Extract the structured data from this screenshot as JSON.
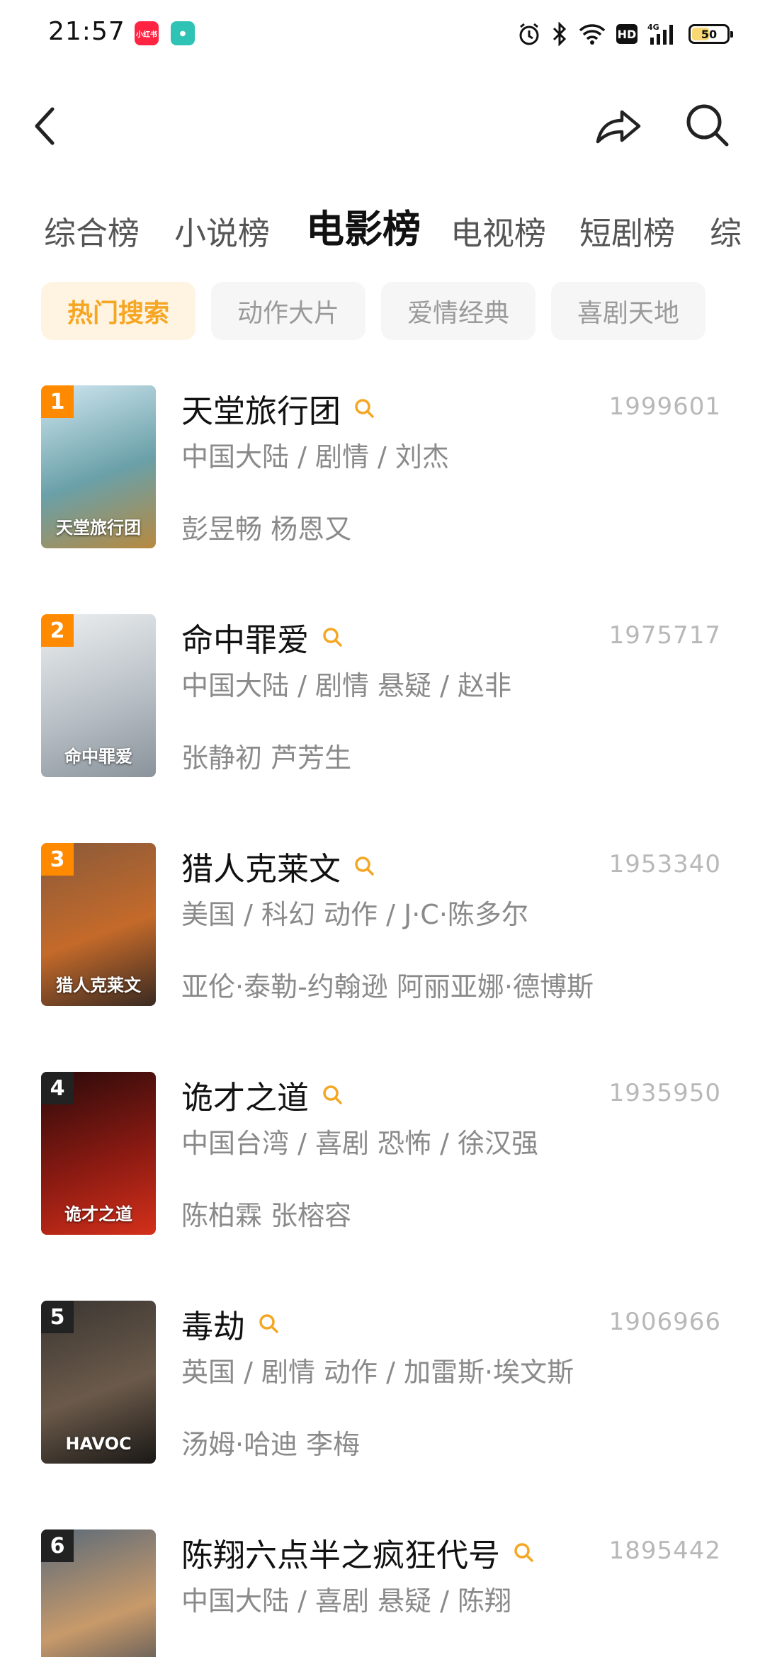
{
  "status_bar": {
    "time": "21:57",
    "app_badges": [
      "小红书",
      "●"
    ],
    "network": "4G",
    "hd": "HD",
    "battery": "50",
    "battery_fraction": 0.5
  },
  "header": {
    "back_icon": "chevron-left-icon",
    "share_icon": "share-arrow-icon",
    "search_icon": "search-icon"
  },
  "category_tabs": [
    {
      "label": "综合榜",
      "active": false
    },
    {
      "label": "小说榜",
      "active": false
    },
    {
      "label": "电影榜",
      "active": true
    },
    {
      "label": "电视榜",
      "active": false
    },
    {
      "label": "短剧榜",
      "active": false
    },
    {
      "label": "综",
      "active": false
    }
  ],
  "filter_chips": [
    {
      "label": "热门搜索",
      "active": true
    },
    {
      "label": "动作大片",
      "active": false
    },
    {
      "label": "爱情经典",
      "active": false
    },
    {
      "label": "喜剧天地",
      "active": false
    }
  ],
  "colors": {
    "accent": "#f5a623",
    "rank_top": "#ff8a00",
    "rank_normal": "#222222"
  },
  "movies": [
    {
      "rank": "1",
      "title": "天堂旅行团",
      "score": "1999601",
      "meta": "中国大陆 / 剧情 / 刘杰",
      "cast": "彭昱畅 杨恩又",
      "poster_text": "天堂旅行团",
      "poster_colors": [
        "#cfe6f0",
        "#6aa0a8",
        "#b7893f"
      ]
    },
    {
      "rank": "2",
      "title": "命中罪爱",
      "score": "1975717",
      "meta": "中国大陆 / 剧情 悬疑 / 赵非",
      "cast": "张静初 芦芳生",
      "poster_text": "命中罪爱",
      "poster_colors": [
        "#eceff1",
        "#b9c0c6",
        "#8a939b"
      ]
    },
    {
      "rank": "3",
      "title": "猎人克莱文",
      "score": "1953340",
      "meta": "美国 / 科幻 动作 / J·C·陈多尔",
      "cast": "亚伦·泰勒-约翰逊 阿丽亚娜·德博斯",
      "poster_text": "猎人克莱文",
      "poster_colors": [
        "#8a5a3a",
        "#c46a2a",
        "#3a2a22"
      ]
    },
    {
      "rank": "4",
      "title": "诡才之道",
      "score": "1935950",
      "meta": "中国台湾 / 喜剧 恐怖 / 徐汉强",
      "cast": "陈柏霖 张榕容",
      "poster_text": "诡才之道",
      "poster_colors": [
        "#2a0a0a",
        "#8a1a12",
        "#d4301a"
      ]
    },
    {
      "rank": "5",
      "title": "毒劫",
      "score": "1906966",
      "meta": "英国 / 剧情 动作 / 加雷斯·埃文斯",
      "cast": "汤姆·哈迪 李梅",
      "poster_text": "HAVOC",
      "poster_colors": [
        "#3a3632",
        "#6b5a4a",
        "#1a1816"
      ]
    },
    {
      "rank": "6",
      "title": "陈翔六点半之疯狂代号",
      "score": "1895442",
      "meta": "中国大陆 / 喜剧 悬疑 / 陈翔",
      "cast": "",
      "poster_text": "",
      "poster_colors": [
        "#5a6a7a",
        "#c89a6a",
        "#3a4452"
      ]
    }
  ]
}
